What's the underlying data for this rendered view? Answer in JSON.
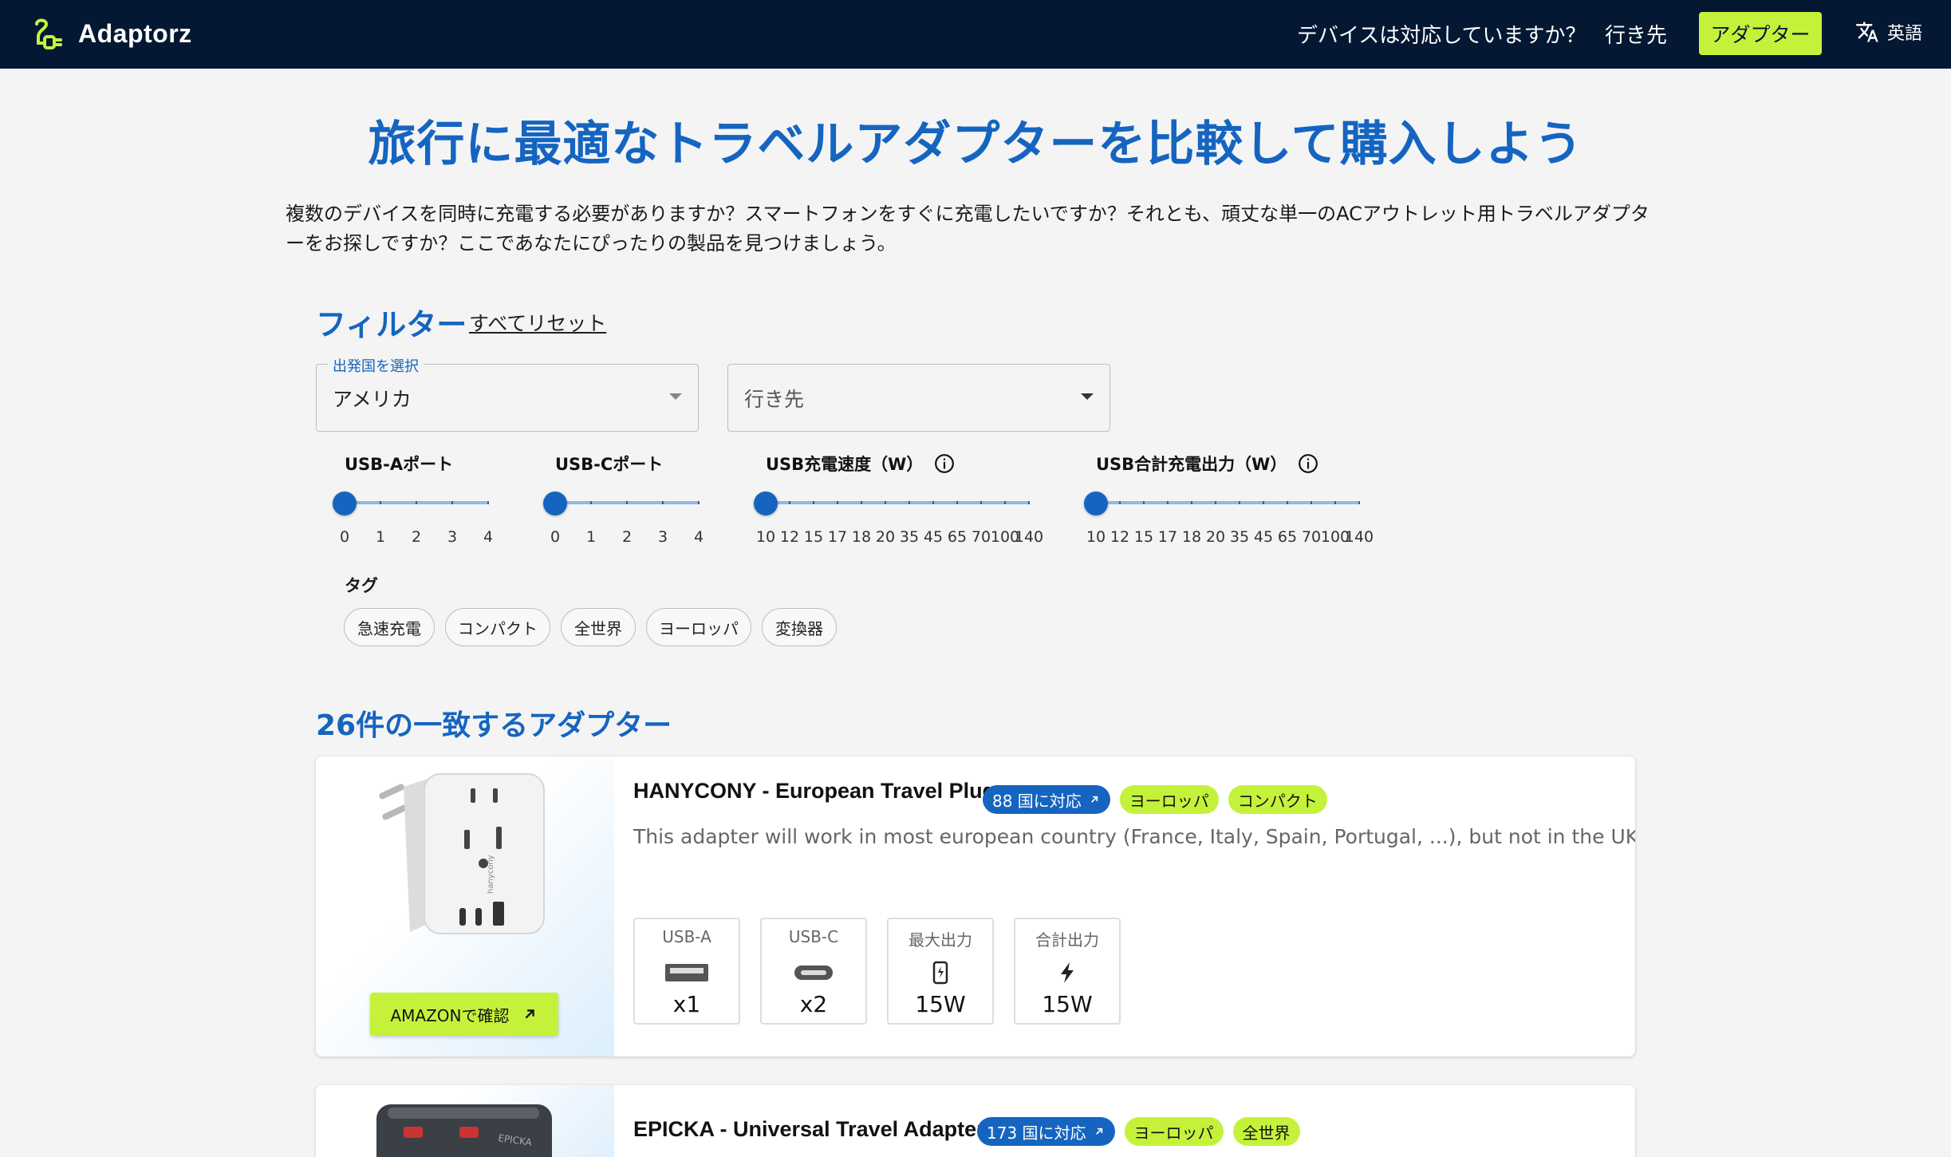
{
  "header": {
    "brand": "Adaptorz",
    "nav_devices": "デバイスは対応していますか？",
    "nav_destination": "行き先",
    "nav_adapter": "アダプター",
    "nav_language": "英語"
  },
  "page": {
    "title": "旅行に最適なトラベルアダプターを比較して購入しよう",
    "intro": "複数のデバイスを同時に充電する必要がありますか？スマートフォンをすぐに充電したいですか？それとも、頑丈な単一のACアウトレット用トラベルアダプターをお探しですか？ここであなたにぴったりの製品を見つけましょう。"
  },
  "filters": {
    "title": "フィルター",
    "reset": "すべてリセット",
    "origin_label": "出発国を選択",
    "origin_value": "アメリカ",
    "destination_placeholder": "行き先",
    "usb_a": {
      "label": "USB-Aポート",
      "ticks": [
        "0",
        "1",
        "2",
        "3",
        "4"
      ],
      "value": "0"
    },
    "usb_c": {
      "label": "USB-Cポート",
      "ticks": [
        "0",
        "1",
        "2",
        "3",
        "4"
      ],
      "value": "0"
    },
    "usb_speed": {
      "label": "USB充電速度（W）",
      "ticks": [
        "10",
        "12",
        "15",
        "17",
        "18",
        "20",
        "35",
        "45",
        "65",
        "70",
        "100",
        "140"
      ],
      "value": "10"
    },
    "usb_total": {
      "label": "USB合計充電出力（W）",
      "ticks": [
        "10",
        "12",
        "15",
        "17",
        "18",
        "20",
        "35",
        "45",
        "65",
        "70",
        "100",
        "140"
      ],
      "value": "10"
    },
    "tags_label": "タグ",
    "tags": [
      "急速充電",
      "コンパクト",
      "全世界",
      "ヨーロッパ",
      "変換器"
    ]
  },
  "results": {
    "title": "26件の一致するアダプター",
    "products": [
      {
        "name": "HANYCONY - European Travel Plug",
        "countries_badge": "88 国に対応",
        "tags": [
          "ヨーロッパ",
          "コンパクト"
        ],
        "description": "This adapter will work in most european country (France, Italy, Spain, Portugal, ...), but not in the UK.",
        "amazon_label": "AMAZONで確認",
        "specs": [
          {
            "label": "USB-A",
            "value": "x1",
            "icon": "usb-a-icon"
          },
          {
            "label": "USB-C",
            "value": "x2",
            "icon": "usb-c-icon"
          },
          {
            "label": "最大出力",
            "value": "15W",
            "icon": "phone-charging-icon"
          },
          {
            "label": "合計出力",
            "value": "15W",
            "icon": "bolt-icon"
          }
        ]
      },
      {
        "name": "EPICKA - Universal Travel Adapter",
        "countries_badge": "173 国に対応",
        "tags": [
          "ヨーロッパ",
          "全世界"
        ]
      }
    ]
  },
  "colors": {
    "navy": "#041833",
    "lime": "#c4f23a",
    "blue": "#1565c0"
  }
}
